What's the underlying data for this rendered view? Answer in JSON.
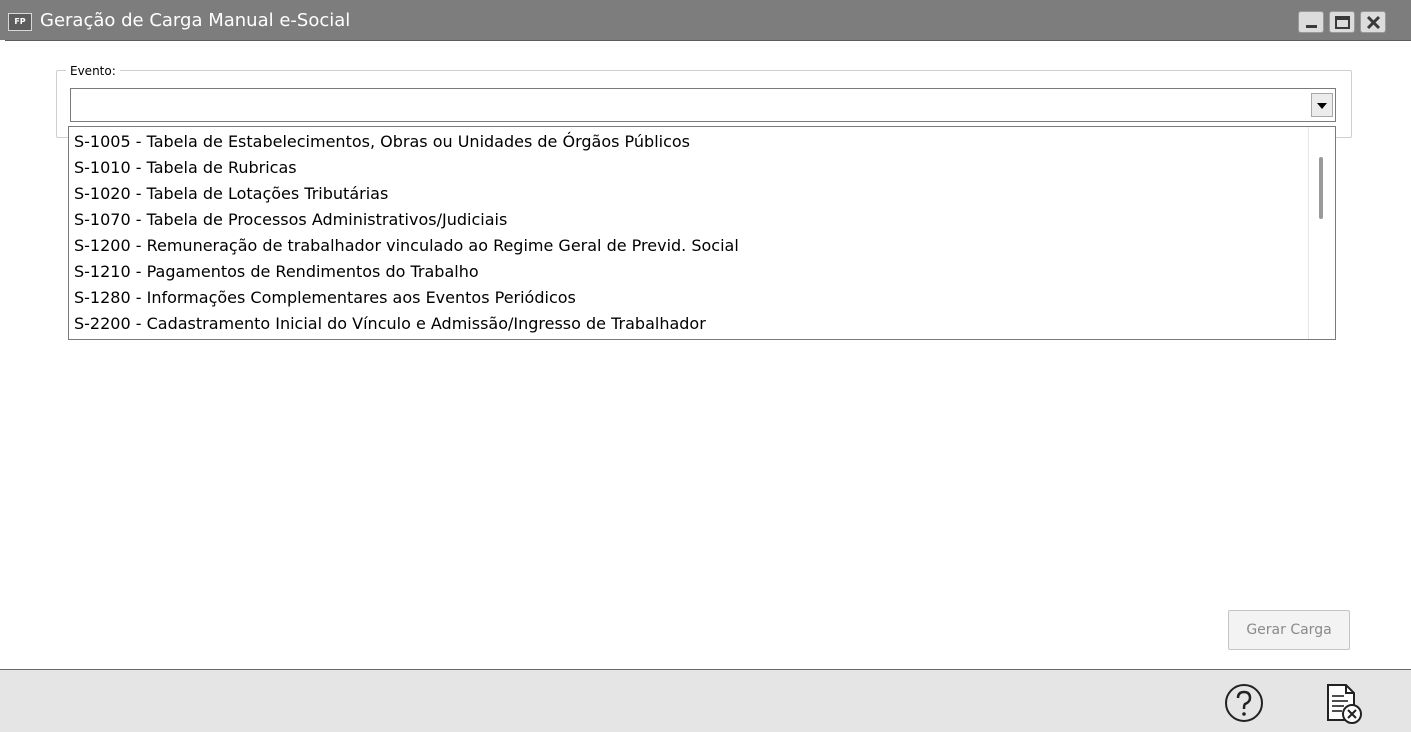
{
  "window": {
    "title": "Geração de Carga Manual e-Social",
    "app_icon_text": "FP"
  },
  "evento": {
    "label": "Evento:",
    "selected_value": ""
  },
  "dropdown": {
    "items": [
      "S-1005 - Tabela de Estabelecimentos, Obras ou Unidades de Órgãos Públicos",
      "S-1010 - Tabela de Rubricas",
      "S-1020 - Tabela de Lotações Tributárias",
      "S-1070 - Tabela de Processos Administrativos/Judiciais",
      "S-1200 - Remuneração de trabalhador vinculado ao Regime Geral de Previd. Social",
      "S-1210 - Pagamentos de Rendimentos do Trabalho",
      "S-1280 - Informações Complementares aos Eventos Periódicos",
      "S-2200 - Cadastramento Inicial do Vínculo e Admissão/Ingresso de Trabalhador"
    ]
  },
  "actions": {
    "gerar_carga": "Gerar Carga"
  },
  "footer": {
    "help_icon": "help-circle-icon",
    "close_icon": "document-close-icon"
  },
  "colors": {
    "titlebar": "#7d7d7d",
    "footer": "#e5e5e5",
    "disabled_text": "#8a8a8a"
  }
}
